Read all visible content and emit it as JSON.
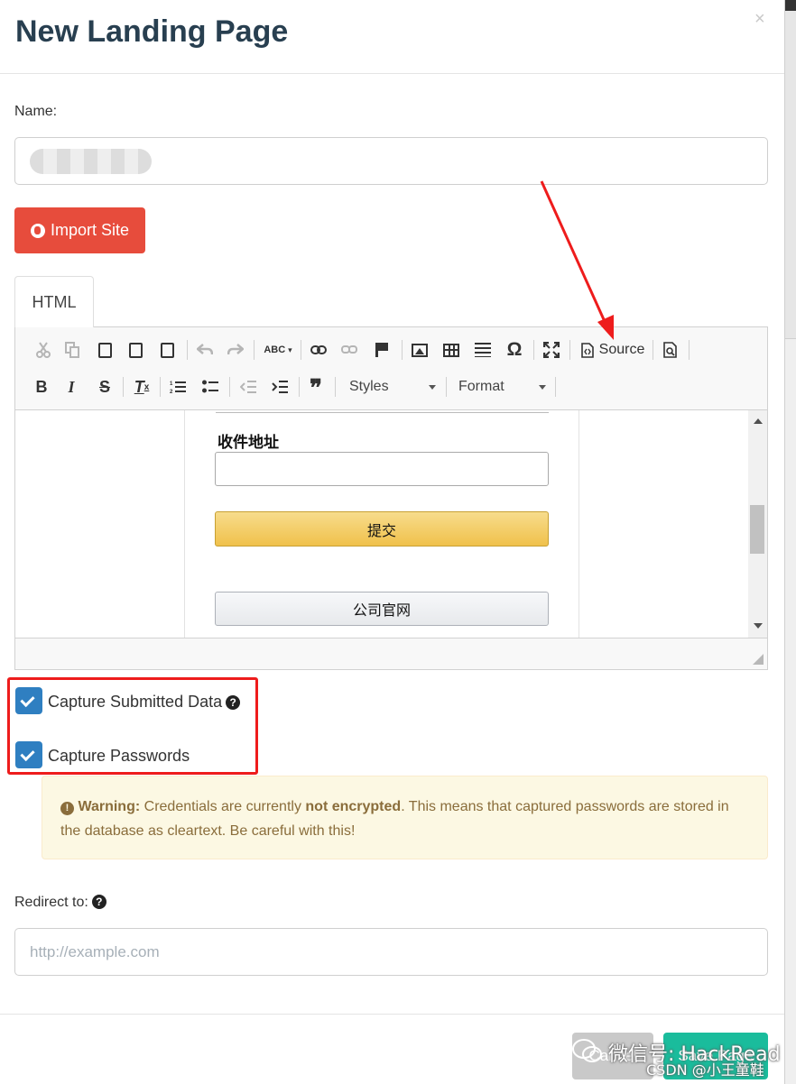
{
  "modal": {
    "title": "New Landing Page",
    "close_symbol": "×"
  },
  "name_field": {
    "label": "Name:"
  },
  "import_button": {
    "label": "Import Site",
    "icon": "globe-icon"
  },
  "editor": {
    "tab_label": "HTML",
    "toolbar": {
      "source_label": "Source",
      "styles_label": "Styles",
      "format_label": "Format",
      "spellcheck_label": "ABC",
      "omega_symbol": "Ω",
      "quote_symbol": "❞"
    },
    "content": {
      "field_label": "收件地址",
      "submit_label": "提交",
      "website_label": "公司官网"
    }
  },
  "capture": {
    "submitted_label": "Capture Submitted Data",
    "passwords_label": "Capture Passwords",
    "help_symbol": "?"
  },
  "warning": {
    "title": "Warning:",
    "text_1": "Credentials are currently",
    "emphasis": "not encrypted",
    "text_2": ". This means that captured passwords are stored in the database as cleartext. Be careful with this!",
    "icon_symbol": "!"
  },
  "redirect": {
    "label": "Redirect to:",
    "placeholder": "http://example.com"
  },
  "footer": {
    "cancel_label": "Cancel",
    "save_label": "Save Page"
  },
  "watermark": {
    "line_1": "微信号: HackRead",
    "line_2": "CSDN @小王童鞋"
  },
  "colors": {
    "title": "#283f50",
    "import_button": "#e74c3c",
    "checkbox": "#2f7fc1",
    "annotation": "#ee1c1c",
    "warning_bg": "#fcf8e3",
    "warning_text": "#8a6d3b",
    "save_button": "#1abc9c"
  }
}
